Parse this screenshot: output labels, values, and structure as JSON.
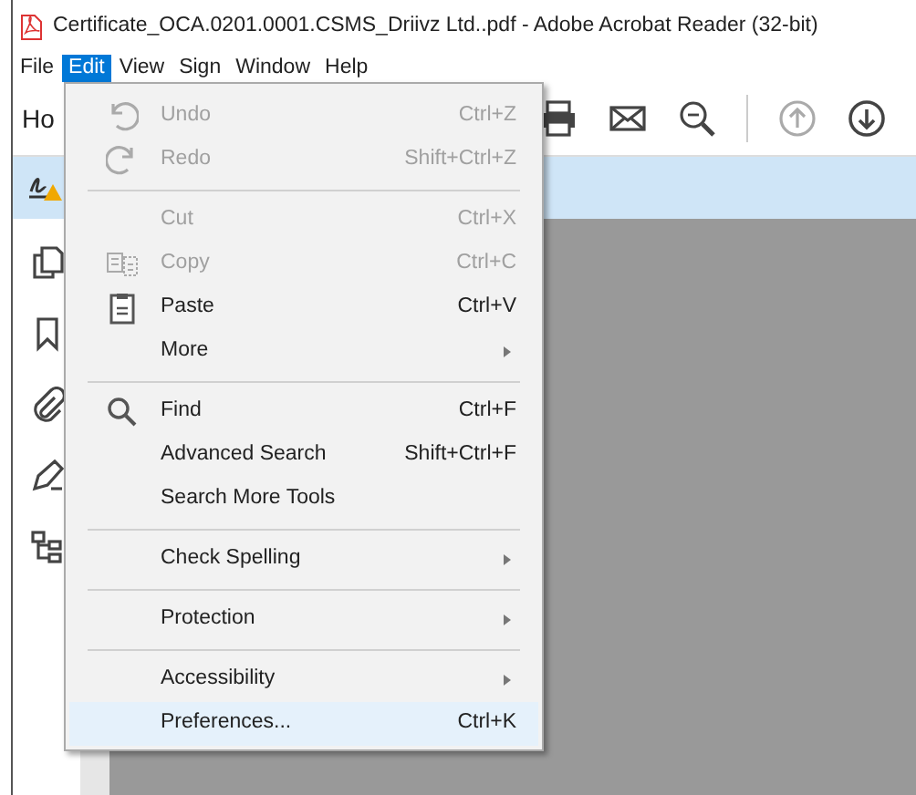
{
  "window": {
    "title": "Certificate_OCA.0201.0001.CSMS_Driivz Ltd..pdf - Adobe Acrobat Reader (32-bit)"
  },
  "menubar": [
    {
      "label": "File",
      "selected": false
    },
    {
      "label": "Edit",
      "selected": true
    },
    {
      "label": "View",
      "selected": false
    },
    {
      "label": "Sign",
      "selected": false
    },
    {
      "label": "Window",
      "selected": false
    },
    {
      "label": "Help",
      "selected": false
    }
  ],
  "toolbar": {
    "tab": "Ho"
  },
  "edit_menu": {
    "groups": [
      [
        {
          "kind": "undo",
          "label": "Undo",
          "shortcut": "Ctrl+Z",
          "disabled": true,
          "submenu": false,
          "selected": false
        },
        {
          "kind": "redo",
          "label": "Redo",
          "shortcut": "Shift+Ctrl+Z",
          "disabled": true,
          "submenu": false,
          "selected": false
        }
      ],
      [
        {
          "kind": "plain",
          "label": "Cut",
          "shortcut": "Ctrl+X",
          "disabled": true,
          "submenu": false,
          "selected": false
        },
        {
          "kind": "copy",
          "label": "Copy",
          "shortcut": "Ctrl+C",
          "disabled": true,
          "submenu": false,
          "selected": false
        },
        {
          "kind": "paste",
          "label": "Paste",
          "shortcut": "Ctrl+V",
          "disabled": false,
          "submenu": false,
          "selected": false
        },
        {
          "kind": "plain",
          "label": "More",
          "disabled": false,
          "submenu": true,
          "selected": false
        }
      ],
      [
        {
          "kind": "find",
          "label": "Find",
          "shortcut": "Ctrl+F",
          "disabled": false,
          "submenu": false,
          "selected": false
        },
        {
          "kind": "plain",
          "label": "Advanced Search",
          "shortcut": "Shift+Ctrl+F",
          "disabled": false,
          "submenu": false,
          "selected": false
        },
        {
          "kind": "plain",
          "label": "Search More Tools",
          "disabled": false,
          "submenu": false,
          "selected": false
        }
      ],
      [
        {
          "kind": "plain",
          "label": "Check Spelling",
          "disabled": false,
          "submenu": true,
          "selected": false
        }
      ],
      [
        {
          "kind": "plain",
          "label": "Protection",
          "disabled": false,
          "submenu": true,
          "selected": false
        }
      ],
      [
        {
          "kind": "plain",
          "label": "Accessibility",
          "disabled": false,
          "submenu": true,
          "selected": false
        },
        {
          "kind": "plain",
          "label": "Preferences...",
          "shortcut": "Ctrl+K",
          "disabled": false,
          "submenu": false,
          "selected": true
        }
      ]
    ]
  }
}
